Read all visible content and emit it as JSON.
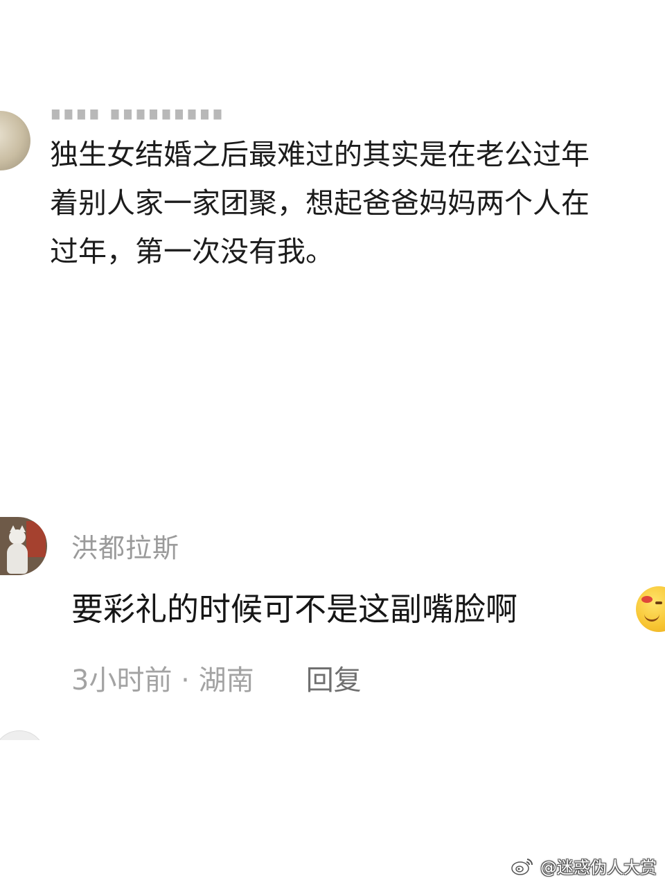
{
  "top_comment": {
    "lines": [
      "独生女结婚之后最难过的其实是在老公过年",
      "着别人家一家团聚，想起爸爸妈妈两个人在",
      "过年，第一次没有我。"
    ]
  },
  "main_comment": {
    "username": "洪都拉斯",
    "text": "要彩礼的时候可不是这副嘴脸啊",
    "meta": "3小时前 · 湖南",
    "reply_label": "回复"
  },
  "watermark": {
    "icon": "weibo-icon",
    "text": "@迷惑伪人大赏"
  }
}
